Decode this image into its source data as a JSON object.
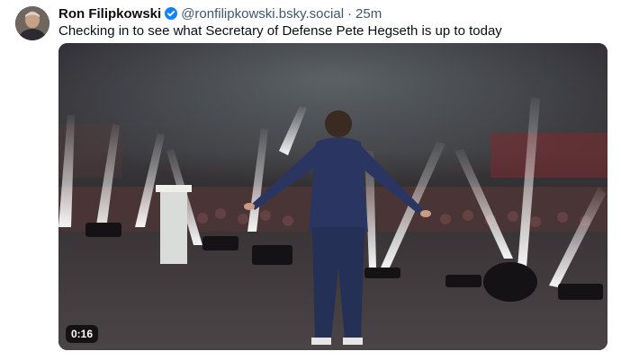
{
  "post": {
    "author": {
      "display_name": "Ron Filipkowski",
      "handle": "@ronfilipkowski.bsky.social",
      "verified_icon": "verified-badge-icon",
      "timestamp": "25m",
      "separator": "·"
    },
    "text": "Checking in to see what Secretary of Defense Pete Hegseth is up to today",
    "video": {
      "duration": "0:16"
    }
  },
  "colors": {
    "verified": "#1083fe",
    "secondary_text": "#42576c",
    "primary_text": "#0b0f14"
  }
}
